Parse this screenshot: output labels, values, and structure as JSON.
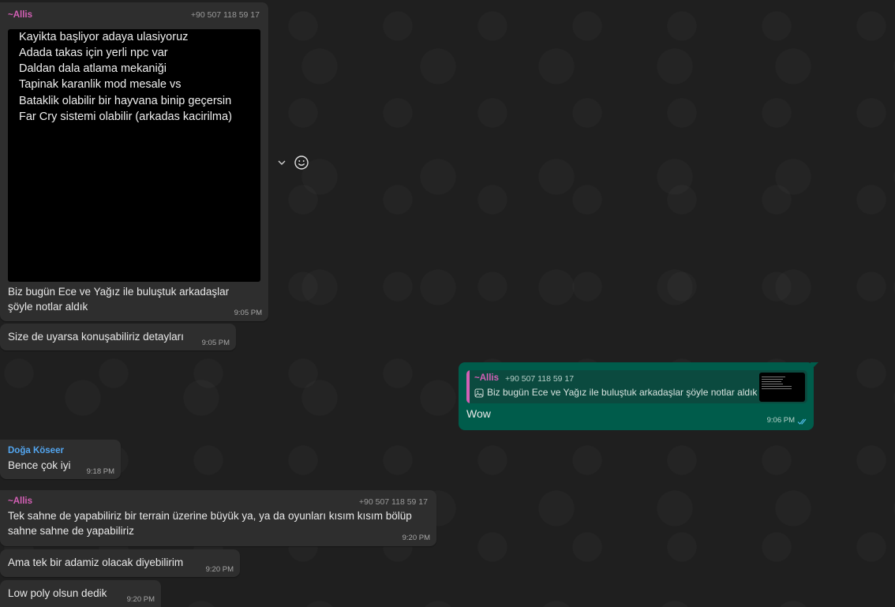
{
  "messages": [
    {
      "sender": "~Allis",
      "phone": "+90 507 118 59 17",
      "image_lines": [
        "Kayikta başliyor adaya ulasiyoruz",
        "Adada takas için yerli npc var",
        "Daldan dala atlama mekaniği",
        "Tapinak karanlik mod mesale vs",
        "Bataklik olabilir bir hayvana binip geçersin",
        "Far Cry sistemi olabilir (arkadas kacirilma)"
      ],
      "caption_line1": "Biz bugün Ece ve Yağız ile buluştuk arkadaşlar",
      "caption_line2": "şöyle notlar aldık",
      "time": "9:05 PM"
    },
    {
      "text": "Size de uyarsa konuşabiliriz detayları",
      "time": "9:05 PM"
    },
    {
      "outgoing": true,
      "quote_sender": "~Allis",
      "quote_phone": "+90 507 118 59 17",
      "quote_text": "Biz bugün Ece ve Yağız ile buluştuk arkadaşlar şöyle notlar aldık",
      "text": "Wow",
      "time": "9:06 PM",
      "status": "read"
    },
    {
      "sender": "Doğa Köseer",
      "text": "Bence çok iyi",
      "time": "9:18 PM"
    },
    {
      "sender": "~Allis",
      "phone": "+90 507 118 59 17",
      "line1": "Tek sahne de yapabiliriz bir terrain üzerine büyük ya, ya da oyunları kısım kısım bölüp",
      "line2": "sahne sahne de yapabiliriz",
      "time": "9:20 PM"
    },
    {
      "text": "Ama tek bir adamiz olacak diyebilirim",
      "time": "9:20 PM"
    },
    {
      "text": "Low poly olsun dedik",
      "time": "9:20 PM"
    }
  ],
  "colors": {
    "background": "#1f1f1f",
    "incoming_bubble": "#2e2e2e",
    "outgoing_bubble": "#005c4b",
    "allis_name": "#d460b6",
    "doga_name": "#53a6f0",
    "read_ticks": "#53bdeb"
  },
  "icons": [
    "chevron-down-icon",
    "emoji-icon",
    "image-icon",
    "double-check-icon"
  ]
}
